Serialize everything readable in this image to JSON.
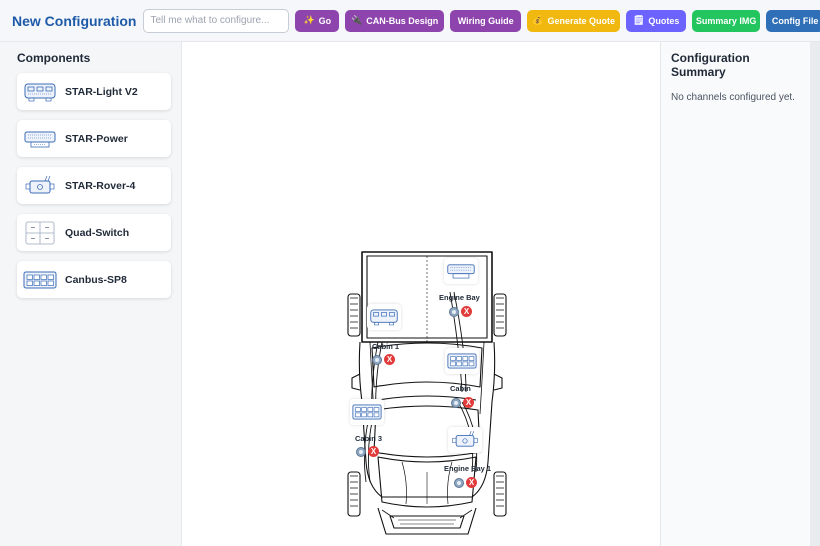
{
  "header": {
    "title": "New Configuration",
    "prompt_placeholder": "Tell me what to configure...",
    "prompt_value": "",
    "buttons": {
      "go": "Go",
      "canbus": "CAN-Bus Design",
      "wiring": "Wiring Guide",
      "quote": "Generate Quote",
      "quotes": "Quotes",
      "summary": "Summary IMG",
      "config": "Config File"
    },
    "button_icons": {
      "go": "sparkles-icon",
      "canbus": "plug-icon",
      "quote": "money-bag-icon",
      "quotes": "notepad-icon"
    }
  },
  "sidebar": {
    "title": "Components",
    "items": [
      {
        "label": "STAR-Light V2",
        "icon": "star-light-module-icon"
      },
      {
        "label": "STAR-Power",
        "icon": "star-power-module-icon"
      },
      {
        "label": "STAR-Rover-4",
        "icon": "star-rover-module-icon"
      },
      {
        "label": "Quad-Switch",
        "icon": "quad-switch-icon"
      },
      {
        "label": "Canbus-SP8",
        "icon": "canbus-keypad-icon"
      }
    ]
  },
  "canvas": {
    "placed": [
      {
        "label": "Engine Bay",
        "component": "STAR-Power"
      },
      {
        "label": "Cabin 1",
        "component": "STAR-Light V2"
      },
      {
        "label": "Cabin",
        "component": "Canbus-SP8"
      },
      {
        "label": "Cabin 3",
        "component": "Canbus-SP8"
      },
      {
        "label": "Engine Bay 1",
        "component": "STAR-Rover-4"
      }
    ],
    "delete_label": "X"
  },
  "summary": {
    "title": "Configuration Summary",
    "empty_text": "No channels configured yet."
  },
  "colors": {
    "title_blue": "#1e5aa8",
    "purple": "#8e44ad",
    "gold": "#f1b90f",
    "indigo": "#6c63ff",
    "green": "#22c55e",
    "blue": "#2e6fb8",
    "delete_red": "#e23b3b"
  }
}
